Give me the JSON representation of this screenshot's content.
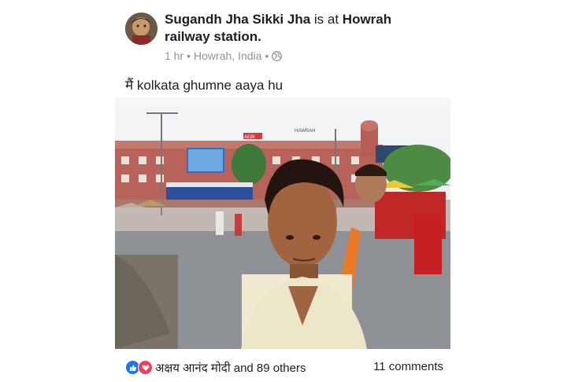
{
  "post": {
    "author": "Sugandh Jha Sikki Jha",
    "connector": " is at ",
    "place_line1": "Howrah",
    "place_line2": "railway station.",
    "time": "1 hr",
    "location": "Howrah, India",
    "separator": "•",
    "privacy_icon": "globe-icon",
    "caption": "मैं kolkata ghumne aaya hu",
    "photo_signs": {
      "station_sign": "HAWRAH",
      "red_sign": "AEBI"
    }
  },
  "footer": {
    "reaction_icons": [
      "like-icon",
      "love-icon"
    ],
    "likes_text": "अक्षय आनंद मोदी and 89 others",
    "comments_text": "11 comments"
  },
  "colors": {
    "like": "#1877f2",
    "love": "#f33e58",
    "meta": "#8d949e"
  }
}
